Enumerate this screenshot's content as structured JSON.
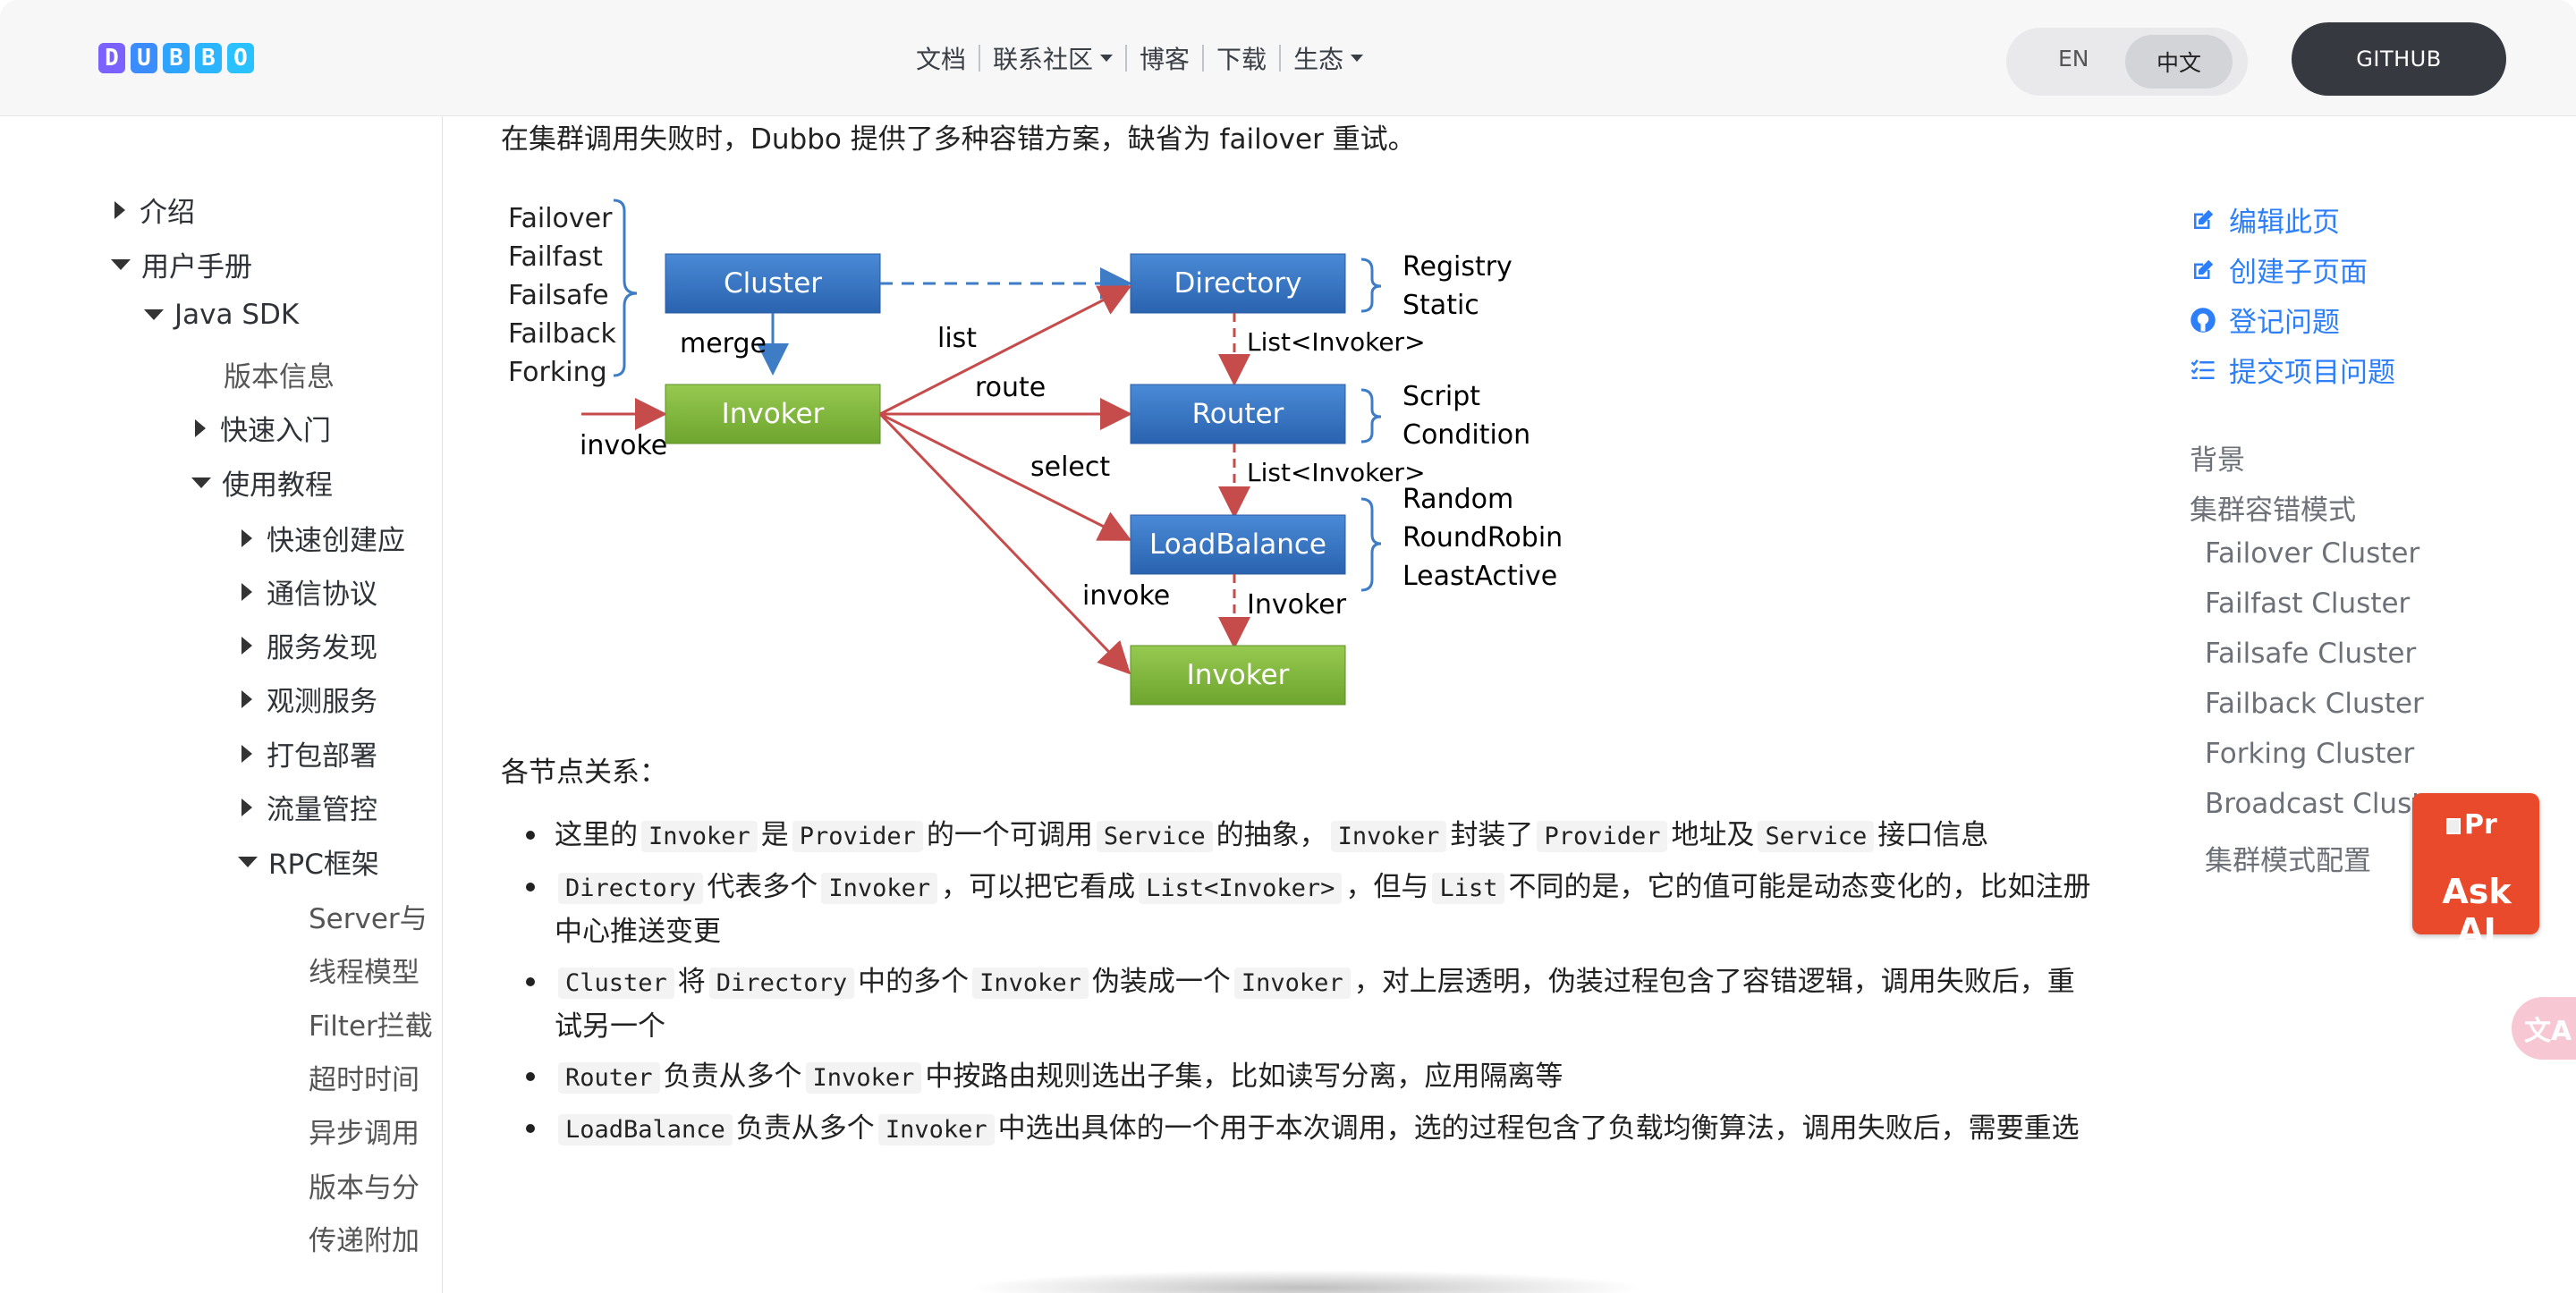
{
  "header": {
    "logo_letters": [
      "D",
      "U",
      "B",
      "B",
      "O"
    ],
    "logo_colors": [
      "#7b61ff",
      "#3b8cff",
      "#2fa4ff",
      "#2bb4ff",
      "#29c1ff"
    ],
    "nav": [
      {
        "label": "文档",
        "dropdown": false
      },
      {
        "label": "联系社区",
        "dropdown": true
      },
      {
        "label": "博客",
        "dropdown": false
      },
      {
        "label": "下载",
        "dropdown": false
      },
      {
        "label": "生态",
        "dropdown": true
      }
    ],
    "lang_en": "EN",
    "lang_zh": "中文",
    "github": "GITHUB"
  },
  "sidebar": [
    {
      "label": "介绍",
      "level": 0,
      "state": "collapsed"
    },
    {
      "label": "用户手册",
      "level": 0,
      "state": "expanded"
    },
    {
      "label": "Java SDK",
      "level": 1,
      "state": "expanded"
    },
    {
      "label": "版本信息",
      "level": 2,
      "state": "leaf"
    },
    {
      "label": "快速入门",
      "level": 2,
      "state": "collapsed"
    },
    {
      "label": "使用教程",
      "level": 2,
      "state": "expanded"
    },
    {
      "label": "快速创建应",
      "level": 3,
      "state": "collapsed"
    },
    {
      "label": "通信协议",
      "level": 3,
      "state": "collapsed"
    },
    {
      "label": "服务发现",
      "level": 3,
      "state": "collapsed"
    },
    {
      "label": "观测服务",
      "level": 3,
      "state": "collapsed"
    },
    {
      "label": "打包部署",
      "level": 3,
      "state": "collapsed"
    },
    {
      "label": "流量管控",
      "level": 3,
      "state": "collapsed"
    },
    {
      "label": "RPC框架",
      "level": 3,
      "state": "expanded"
    },
    {
      "label": "Server与",
      "level": 4,
      "state": "leaf"
    },
    {
      "label": "线程模型",
      "level": 4,
      "state": "leaf"
    },
    {
      "label": "Filter拦截",
      "level": 4,
      "state": "leaf"
    },
    {
      "label": "超时时间",
      "level": 4,
      "state": "leaf"
    },
    {
      "label": "异步调用",
      "level": 4,
      "state": "leaf"
    },
    {
      "label": "版本与分",
      "level": 4,
      "state": "leaf"
    },
    {
      "label": "传递附加",
      "level": 4,
      "state": "leaf"
    }
  ],
  "content": {
    "intro": "在集群调用失败时，Dubbo 提供了多种容错方案，缺省为 failover 重试。",
    "diagram": {
      "cluster_modes": [
        "Failover",
        "Failfast",
        "Failsafe",
        "Failback",
        "Forking"
      ],
      "boxes": {
        "cluster": "Cluster",
        "directory": "Directory",
        "router": "Router",
        "loadbalance": "LoadBalance",
        "invoker1": "Invoker",
        "invoker2": "Invoker"
      },
      "directory_types": [
        "Registry",
        "Static"
      ],
      "router_types": [
        "Script",
        "Condition"
      ],
      "lb_types": [
        "Random",
        "RoundRobin",
        "LeastActive"
      ],
      "labels": {
        "merge": "merge",
        "invoke_in": "invoke",
        "list": "list",
        "route": "route",
        "select": "select",
        "invoke_out": "invoke",
        "list_invoker1": "List<Invoker>",
        "list_invoker2": "List<Invoker>",
        "invoker_arrow": "Invoker"
      }
    },
    "subtitle": "各节点关系：",
    "bullets": [
      [
        {
          "t": "这里的"
        },
        {
          "c": "Invoker"
        },
        {
          "t": "是"
        },
        {
          "c": "Provider"
        },
        {
          "t": "的一个可调用"
        },
        {
          "c": "Service"
        },
        {
          "t": "的抽象，"
        },
        {
          "c": "Invoker"
        },
        {
          "t": "封装了"
        },
        {
          "c": "Provider"
        },
        {
          "t": "地址及"
        },
        {
          "c": "Service"
        },
        {
          "t": "接口信息"
        }
      ],
      [
        {
          "c": "Directory"
        },
        {
          "t": "代表多个"
        },
        {
          "c": "Invoker"
        },
        {
          "t": "，可以把它看成"
        },
        {
          "c": "List<Invoker>"
        },
        {
          "t": "，但与"
        },
        {
          "c": "List"
        },
        {
          "t": "不同的是，它的值可能是动态变化的，比如注册中心推送变更"
        }
      ],
      [
        {
          "c": "Cluster"
        },
        {
          "t": "将"
        },
        {
          "c": "Directory"
        },
        {
          "t": "中的多个"
        },
        {
          "c": "Invoker"
        },
        {
          "t": "伪装成一个"
        },
        {
          "c": "Invoker"
        },
        {
          "t": "，对上层透明，伪装过程包含了容错逻辑，调用失败后，重试另一个"
        }
      ],
      [
        {
          "c": "Router"
        },
        {
          "t": "负责从多个"
        },
        {
          "c": "Invoker"
        },
        {
          "t": "中按路由规则选出子集，比如读写分离，应用隔离等"
        }
      ],
      [
        {
          "c": "LoadBalance"
        },
        {
          "t": "负责从多个"
        },
        {
          "c": "Invoker"
        },
        {
          "t": "中选出具体的一个用于本次调用，选的过程包含了负载均衡算法，调用失败后，需要重选"
        }
      ]
    ]
  },
  "toc": {
    "actions": [
      {
        "label": "编辑此页",
        "icon": "edit-icon"
      },
      {
        "label": "创建子页面",
        "icon": "edit-icon"
      },
      {
        "label": "登记问题",
        "icon": "github-icon"
      },
      {
        "label": "提交项目问题",
        "icon": "tasklist-icon"
      }
    ],
    "links": [
      {
        "label": "背景",
        "level": 0
      },
      {
        "label": "集群容错模式",
        "level": 0
      },
      {
        "label": "Failover Cluster",
        "level": 1
      },
      {
        "label": "Failfast Cluster",
        "level": 1
      },
      {
        "label": "Failsafe Cluster",
        "level": 1
      },
      {
        "label": "Failback Cluster",
        "level": 1
      },
      {
        "label": "Forking Cluster",
        "level": 1
      },
      {
        "label": "Broadcast Cluste",
        "level": 1
      },
      {
        "label": "集群模式配置",
        "level": 1
      }
    ]
  },
  "ask_ai": {
    "img_alt": "Pr",
    "label": "Ask AI"
  },
  "translate_icon": "translate-icon",
  "colors": {
    "link": "#2d7ff9",
    "box_blue": "#2f6fbf",
    "box_green": "#7db33a",
    "arrow_red": "#c64b4b",
    "ask_ai": "#e84a2b"
  }
}
